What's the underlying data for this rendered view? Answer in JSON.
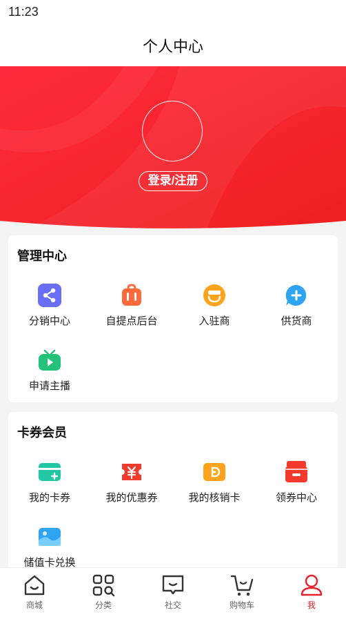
{
  "status_bar": {
    "time": "11:23"
  },
  "header": {
    "title": "个人中心"
  },
  "profile": {
    "login_label": "登录/注册"
  },
  "management": {
    "title": "管理中心",
    "items": [
      {
        "label": "分销中心",
        "icon": "share-icon",
        "color": "#5b6bf2"
      },
      {
        "label": "自提点后台",
        "icon": "store-bag-icon",
        "color": "#ff6a3c"
      },
      {
        "label": "入驻商",
        "icon": "merchant-icon",
        "color": "#ff9a1e"
      },
      {
        "label": "供货商",
        "icon": "supplier-icon",
        "color": "#2ea4f3"
      },
      {
        "label": "申请主播",
        "icon": "tv-play-icon",
        "color": "#22c27a"
      }
    ]
  },
  "coupons": {
    "title": "卡券会员",
    "items": [
      {
        "label": "我的卡券",
        "icon": "card-icon",
        "color": "#22c8a6"
      },
      {
        "label": "我的优惠券",
        "icon": "yen-coupon-icon",
        "color": "#f33a2c"
      },
      {
        "label": "我的核销卡",
        "icon": "verify-card-icon",
        "color": "#ff9a1e"
      },
      {
        "label": "领券中心",
        "icon": "coupon-center-icon",
        "color": "#f33a2c"
      },
      {
        "label": "储值卡兑换",
        "icon": "stored-value-card-icon",
        "color": "#2ea4f3"
      }
    ]
  },
  "tabbar": {
    "items": [
      {
        "label": "商城",
        "icon": "home-icon"
      },
      {
        "label": "分类",
        "icon": "category-icon"
      },
      {
        "label": "社交",
        "icon": "chat-icon"
      },
      {
        "label": "购物车",
        "icon": "cart-icon"
      },
      {
        "label": "我",
        "icon": "profile-icon",
        "active": true
      }
    ],
    "active_color": "#e8202a"
  },
  "colors": {
    "accent": "#f0232b",
    "hero_light": "#ff4a4a"
  }
}
